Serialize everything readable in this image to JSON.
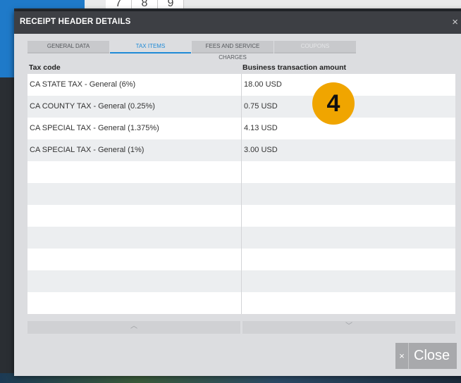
{
  "background": {
    "tiles": [
      "7",
      "8",
      "9"
    ]
  },
  "dialog": {
    "title": "RECEIPT HEADER DETAILS",
    "close_icon": "×",
    "tabs": [
      {
        "label": "GENERAL DATA",
        "state": "normal"
      },
      {
        "label": "TAX ITEMS",
        "state": "active"
      },
      {
        "label": "FEES AND SERVICE CHARGES",
        "state": "normal"
      },
      {
        "label": "COUPONS",
        "state": "disabled"
      }
    ],
    "columns": [
      "Tax code",
      "Business transaction amount"
    ],
    "rows": [
      [
        "CA STATE TAX - General (6%)",
        "18.00 USD"
      ],
      [
        "CA COUNTY TAX - General (0.25%)",
        "0.75 USD"
      ],
      [
        "CA SPECIAL TAX - General (1.375%)",
        "4.13 USD"
      ],
      [
        "CA SPECIAL TAX - General (1%)",
        "3.00 USD"
      ],
      [
        "",
        ""
      ],
      [
        "",
        ""
      ],
      [
        "",
        ""
      ],
      [
        "",
        ""
      ],
      [
        "",
        ""
      ],
      [
        "",
        ""
      ],
      [
        "",
        ""
      ]
    ],
    "scroll_up_icon": "︿",
    "scroll_down_icon": "﹀",
    "close_button": {
      "icon": "×",
      "label": "Close"
    }
  },
  "annotation_badge": "4",
  "colors": {
    "accent": "#1f8ad6",
    "badge": "#f0a500",
    "titlebar": "#3d3f44"
  }
}
